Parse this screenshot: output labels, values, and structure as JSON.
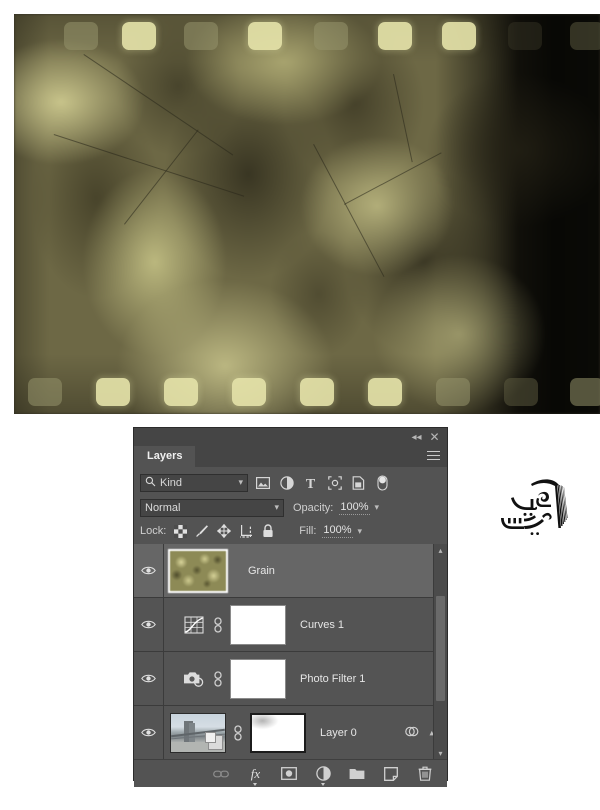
{
  "photo": {
    "alt_name": "film-strip-grunge-texture",
    "description": "Olive/khaki grunge film strip texture with sprocket holes top and bottom and a dark burned right edge",
    "colors": {
      "base": "#6d6845",
      "highlight": "#d7d396",
      "shadow": "#2c291a",
      "burn_edge": "#0a0a05",
      "sprocket": "#e4e2a8"
    }
  },
  "panel": {
    "title": "Layers",
    "topbar": {
      "collapse_icon": "double-chevron-left-icon",
      "close_icon": "close-icon",
      "menu_icon": "panel-menu-icon"
    },
    "filter": {
      "kind_label": "Kind",
      "search_icon": "search-icon",
      "caret_icon": "chevron-down-icon",
      "icons": [
        {
          "name": "filter-pixel-icon",
          "glyph": "image"
        },
        {
          "name": "filter-adjustment-icon",
          "glyph": "half-circle"
        },
        {
          "name": "filter-type-icon",
          "glyph": "T"
        },
        {
          "name": "filter-shape-icon",
          "glyph": "shape"
        },
        {
          "name": "filter-smart-object-icon",
          "glyph": "smart-object"
        },
        {
          "name": "filter-toggle-icon",
          "glyph": "toggle"
        }
      ]
    },
    "blend": {
      "mode": "Normal",
      "opacity_label": "Opacity:",
      "opacity_value": "100%",
      "caret_icon": "chevron-down-icon"
    },
    "lock": {
      "label": "Lock:",
      "fill_label": "Fill:",
      "fill_value": "100%",
      "icons": [
        {
          "name": "lock-transparent-pixels-icon",
          "glyph": "checker"
        },
        {
          "name": "lock-image-pixels-icon",
          "glyph": "brush"
        },
        {
          "name": "lock-position-icon",
          "glyph": "move"
        },
        {
          "name": "lock-artboard-nesting-icon",
          "glyph": "artboard"
        },
        {
          "name": "lock-all-icon",
          "glyph": "padlock"
        }
      ]
    },
    "layers": [
      {
        "name": "Grain",
        "selected": true,
        "visible": true,
        "thumb_type": "grain-texture",
        "has_mask": false,
        "has_link": false,
        "has_fx": false
      },
      {
        "name": "Curves 1",
        "selected": false,
        "visible": true,
        "thumb_type": "curves-adjustment-icon",
        "has_mask": true,
        "mask_type": "plain-white",
        "has_link": true,
        "has_fx": false
      },
      {
        "name": "Photo Filter 1",
        "selected": false,
        "visible": true,
        "thumb_type": "photo-filter-adjustment-icon",
        "has_mask": true,
        "mask_type": "plain-white",
        "has_link": true,
        "has_fx": false
      },
      {
        "name": "Layer 0",
        "selected": false,
        "visible": true,
        "thumb_type": "bridge-photo",
        "has_mask": true,
        "mask_type": "soft-gradient",
        "has_link": true,
        "has_fx": true,
        "fx_icon": "smart-filter-icon",
        "caret_icon": "chevron-up-icon"
      }
    ],
    "scrollbar": {
      "up_arrow": "chevron-up-icon",
      "down_arrow": "chevron-down-icon"
    },
    "footer_buttons": [
      {
        "name": "link-layers-button",
        "glyph": "chain",
        "label": "Link layers",
        "disabled": true
      },
      {
        "name": "layer-style-button",
        "glyph": "fx",
        "label": "Add a layer style"
      },
      {
        "name": "add-layer-mask-button",
        "glyph": "mask",
        "label": "Add layer mask"
      },
      {
        "name": "new-fill-adjustment-button",
        "glyph": "half-circle",
        "label": "Create new fill or adjustment layer"
      },
      {
        "name": "new-group-button",
        "glyph": "folder",
        "label": "Create a new group"
      },
      {
        "name": "new-layer-button",
        "glyph": "page",
        "label": "Create a new layer"
      },
      {
        "name": "delete-layer-button",
        "glyph": "trash",
        "label": "Delete layer"
      }
    ]
  },
  "watermark": {
    "name": "tadris-web-logo",
    "script": "تدریس وب",
    "transliteration": "Tadris Web"
  }
}
